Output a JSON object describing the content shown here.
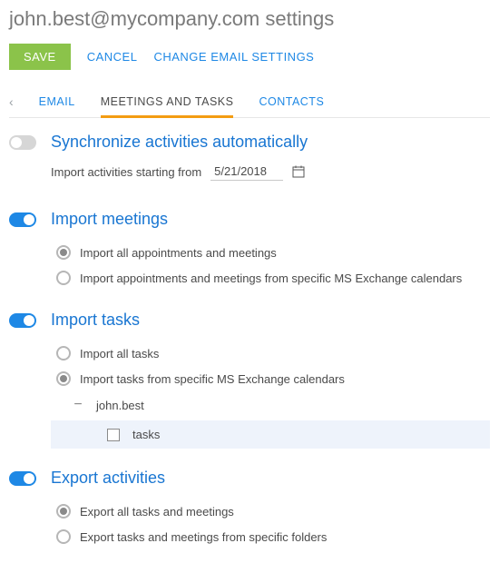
{
  "title": "john.best@mycompany.com settings",
  "actions": {
    "save": "SAVE",
    "cancel": "CANCEL",
    "change_email": "CHANGE EMAIL SETTINGS"
  },
  "tabs": {
    "email": "EMAIL",
    "meetings": "MEETINGS AND TASKS",
    "contacts": "CONTACTS"
  },
  "sections": {
    "sync": {
      "title": "Synchronize activities automatically",
      "enabled": false,
      "date_label": "Import activities starting from",
      "date_value": "5/21/2018"
    },
    "import_meetings": {
      "title": "Import meetings",
      "enabled": true,
      "opt_all": "Import all appointments and meetings",
      "opt_specific": "Import appointments and meetings from specific MS Exchange calendars",
      "selected": "all"
    },
    "import_tasks": {
      "title": "Import tasks",
      "enabled": true,
      "opt_all": "Import all tasks",
      "opt_specific": "Import tasks from specific MS Exchange calendars",
      "selected": "specific",
      "tree": {
        "root": "john.best",
        "child": "tasks",
        "child_checked": false
      }
    },
    "export": {
      "title": "Export activities",
      "enabled": true,
      "opt_all": "Export all tasks and meetings",
      "opt_specific": "Export tasks and meetings from specific folders",
      "selected": "all"
    }
  }
}
